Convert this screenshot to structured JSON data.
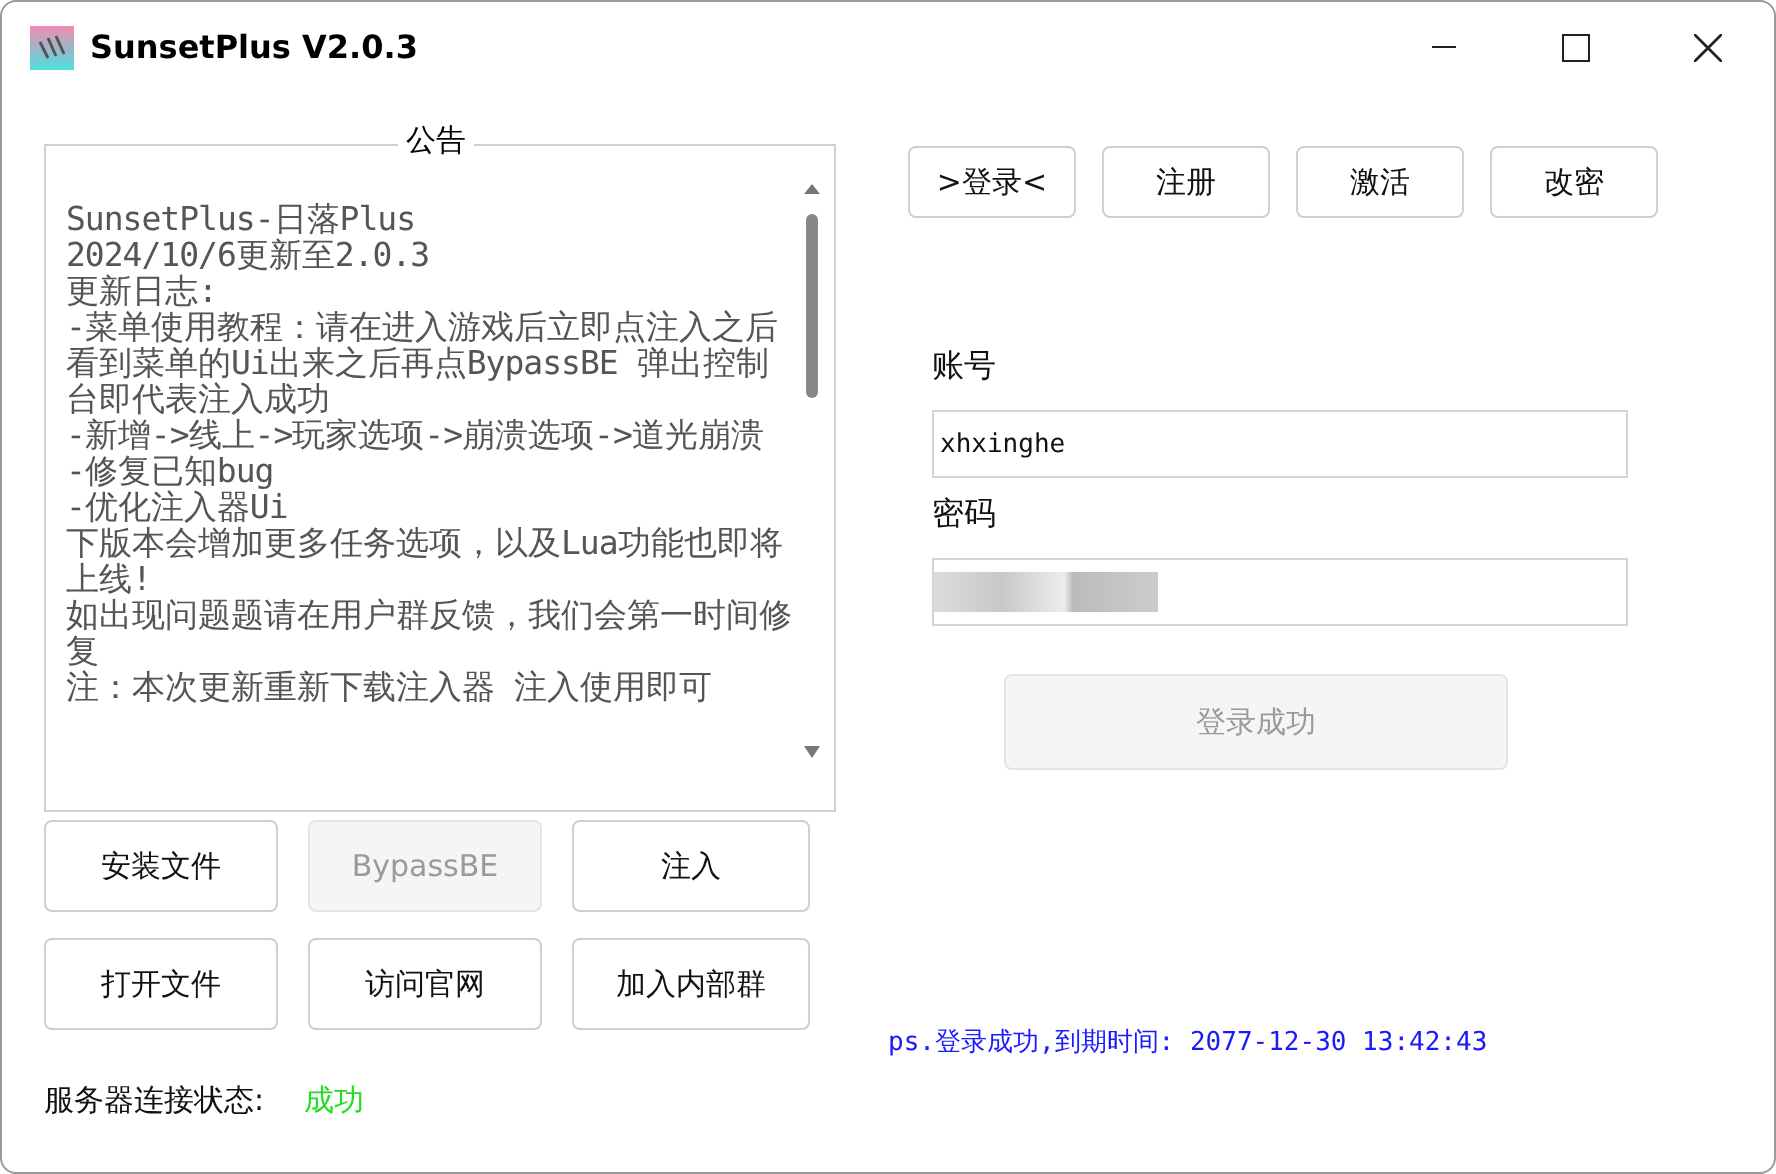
{
  "window": {
    "title": "SunsetPlus V2.0.3"
  },
  "announcement": {
    "title": "公告",
    "lines": [
      "SunsetPlus-日落Plus",
      "2024/10/6更新至2.0.3",
      "更新日志:",
      "-菜单使用教程：请在进入游戏后立即点注入之后看到菜单的Ui出来之后再点BypassBE 弹出控制台即代表注入成功",
      "-新增->线上->玩家选项->崩溃选项->道光崩溃",
      "-修复已知bug",
      "-优化注入器Ui",
      "下版本会增加更多任务选项，以及Lua功能也即将上线!",
      "如出现问题题请在用户群反馈，我们会第一时间修复",
      "注：本次更新重新下载注入器 注入使用即可"
    ]
  },
  "actions": [
    {
      "label": "安装文件",
      "disabled": false
    },
    {
      "label": "BypassBE",
      "disabled": true
    },
    {
      "label": "注入",
      "disabled": false
    },
    {
      "label": "打开文件",
      "disabled": false
    },
    {
      "label": "访问官网",
      "disabled": false
    },
    {
      "label": "加入内部群",
      "disabled": false
    }
  ],
  "server_status": {
    "label": "服务器连接状态:",
    "value": "成功"
  },
  "tabs": [
    ">登录<",
    "注册",
    "激活",
    "改密"
  ],
  "login": {
    "account_label": "账号",
    "account_value": "xhxinghe",
    "password_label": "密码",
    "submit": {
      "label": "登录成功",
      "disabled": true
    }
  },
  "status_message": "ps.登录成功,到期时间: 2077-12-30 13:42:43"
}
